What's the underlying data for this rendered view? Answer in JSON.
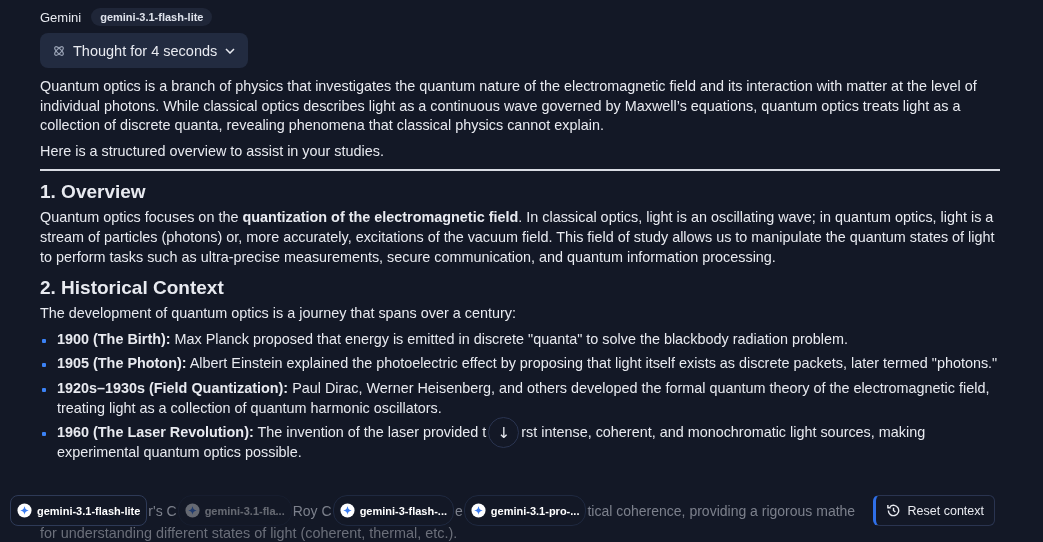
{
  "header": {
    "label": "Gemini",
    "model": "gemini-3.1-flash-lite"
  },
  "thought": {
    "label": "Thought for 4 seconds",
    "expanded": false
  },
  "blocks": [
    {
      "kind": "p",
      "text": "Quantum optics is a branch of physics that investigates the quantum nature of the electromagnetic field and its interaction with matter at the level of individual photons. While classical optics describes light as a continuous wave governed by Maxwell’s equations, quantum optics treats light as a collection of discrete quanta, revealing phenomena that classical physics cannot explain."
    },
    {
      "kind": "p",
      "text": "Here is a structured overview to assist in your studies."
    },
    {
      "kind": "rule"
    },
    {
      "kind": "h2",
      "text": "1. Overview"
    },
    {
      "kind": "p",
      "text": "Quantum optics focuses on the **quantization of the electromagnetic field**. In classical optics, light is an oscillating wave; in quantum optics, light is a stream of particles (photons) or, more accurately, excitations of the vacuum field. This field of study allows us to manipulate the quantum states of light to perform tasks such as ultra-precise measurements, secure communication, and quantum information processing."
    },
    {
      "kind": "h2",
      "text": "2. Historical Context"
    },
    {
      "kind": "p",
      "text": "The development of quantum optics is a journey that spans over a century:"
    },
    {
      "kind": "bullets",
      "items": [
        {
          "kind": "text",
          "text": "**1900 (The Birth):** Max Planck proposed that energy is emitted in discrete \"quanta\" to solve the blackbody radiation problem."
        },
        {
          "kind": "text",
          "text": "**1905 (The Photon):** Albert Einstein explained the photoelectric effect by proposing that light itself exists as discrete packets, later termed \"photons.\""
        },
        {
          "kind": "text",
          "text": "**1920s–1930s (Field Quantization):** Paul Dirac, Werner Heisenberg, and others developed the formal quantum theory of the electromagnetic field, treating light as a collection of quantum harmonic oscillators."
        },
        {
          "kind": "covered",
          "before": "**1960 (The Laser Revolution):** The invention of the laser provided t",
          "button": "↓",
          "after": "rst intense, coherent, and monochromatic light sources, making",
          "line_2": "experimental quantum optics possible."
        }
      ]
    }
  ],
  "bottom_bar": [
    {
      "kind": "chip",
      "label": "gemini-3.1-flash-lite",
      "selected": true
    },
    {
      "kind": "fragment",
      "text": "r's C"
    },
    {
      "kind": "ghost-chip",
      "label": "gemini-3.1-fla..."
    },
    {
      "kind": "fragment",
      "text": "Roy C"
    },
    {
      "kind": "chip",
      "label": "gemini-3-flash-...",
      "selected": false
    },
    {
      "kind": "fragment",
      "text": "e"
    },
    {
      "kind": "chip",
      "label": "gemini-3.1-pro-...",
      "selected": false
    },
    {
      "kind": "fragment",
      "text": "tical coherence, providing a rigorous mathe"
    },
    {
      "kind": "button",
      "label": "Reset context"
    }
  ],
  "faded_line": "for understanding different states of light (coherent, thermal, etc.)."
}
